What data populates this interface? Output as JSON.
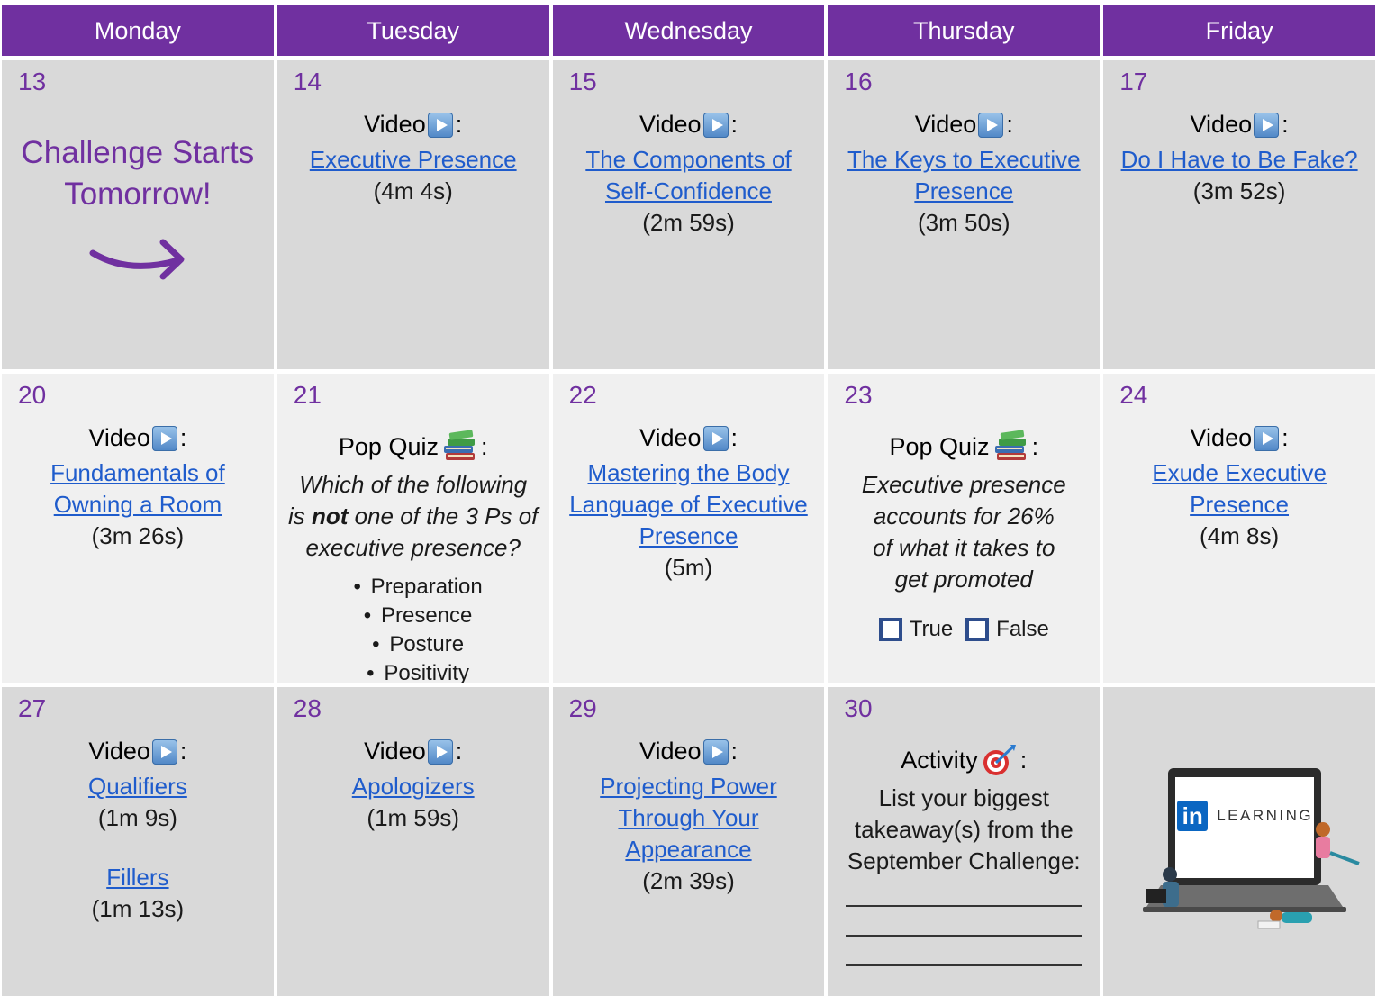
{
  "days": [
    "Monday",
    "Tuesday",
    "Wednesday",
    "Thursday",
    "Friday"
  ],
  "week1": {
    "mon": {
      "num": "13",
      "line1": "Challenge Starts",
      "line2": "Tomorrow!"
    },
    "tue": {
      "num": "14",
      "kind": "Video",
      "link": "Executive Presence",
      "dur": "(4m 4s)"
    },
    "wed": {
      "num": "15",
      "kind": "Video",
      "link1": "The Components of",
      "link2": "Self-Confidence",
      "dur": "(2m 59s)"
    },
    "thu": {
      "num": "16",
      "kind": "Video",
      "link1": "The Keys to Executive",
      "link2": "Presence",
      "dur": "(3m 50s)"
    },
    "fri": {
      "num": "17",
      "kind": "Video",
      "link": "Do I Have to Be Fake?",
      "dur": "(3m 52s)"
    }
  },
  "week2": {
    "mon": {
      "num": "20",
      "kind": "Video",
      "link1": "Fundamentals of",
      "link2": "Owning a Room",
      "dur": "(3m 26s)"
    },
    "tue": {
      "num": "21",
      "kind": "Pop Quiz",
      "q1": "Which of the following",
      "q2a": "is ",
      "q2b": "not",
      "q2c": " one of the 3 Ps of",
      "q3": "executive presence?",
      "options": [
        "Preparation",
        "Presence",
        "Posture",
        "Positivity"
      ],
      "bullet": "•"
    },
    "wed": {
      "num": "22",
      "kind": "Video",
      "link1": "Mastering the Body",
      "link2": "Language of Executive",
      "link3": "Presence",
      "dur": "(5m)"
    },
    "thu": {
      "num": "23",
      "kind": "Pop Quiz",
      "q": [
        "Executive presence",
        "accounts for 26%",
        "of what it takes to",
        "get promoted"
      ],
      "true_label": "True",
      "false_label": "False"
    },
    "fri": {
      "num": "24",
      "kind": "Video",
      "link1": "Exude Executive",
      "link2": "Presence",
      "dur": "(4m 8s)"
    }
  },
  "week3": {
    "mon": {
      "num": "27",
      "kind": "Video",
      "link1": "Qualifiers",
      "dur1": "(1m 9s)",
      "link2": "Fillers",
      "dur2": "(1m 13s)"
    },
    "tue": {
      "num": "28",
      "kind": "Video",
      "link": "Apologizers",
      "dur": "(1m 59s)"
    },
    "wed": {
      "num": "29",
      "kind": "Video",
      "link1": "Projecting Power",
      "link2": "Through Your",
      "link3": "Appearance",
      "dur": "(2m 39s)"
    },
    "thu": {
      "num": "30",
      "kind": "Activity",
      "text": [
        "List your biggest",
        "takeaway(s) from the",
        "September Challenge:"
      ]
    },
    "fri": {
      "logo_in": "in",
      "logo_text": "LEARNING"
    }
  },
  "colon": ":",
  "colors": {
    "header": "#7030a0",
    "link": "#1f5ccc",
    "cell_dark": "#d9d9d9",
    "cell_light": "#f0f0f0",
    "day_number": "#7030a0"
  }
}
